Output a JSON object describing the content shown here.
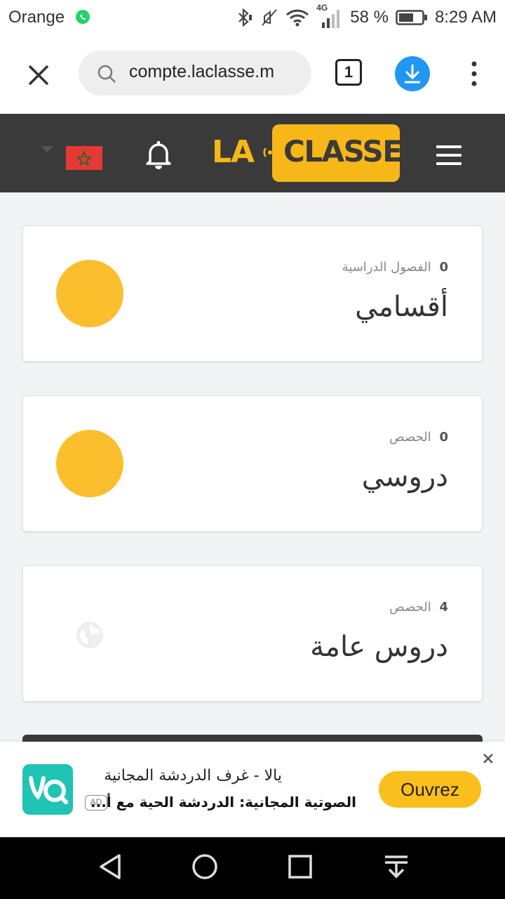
{
  "status_bar": {
    "carrier": "Orange",
    "network": "4G",
    "battery": "58 %",
    "time": "8:29 AM",
    "icons": [
      "whatsapp-icon",
      "bluetooth-icon",
      "mute-icon",
      "wifi-icon",
      "signal-icon",
      "battery-icon"
    ]
  },
  "browser": {
    "url": "compte.laclasse.m",
    "tab_count": "1",
    "icons": [
      "close-icon",
      "search-icon",
      "download-icon",
      "more-icon"
    ]
  },
  "site_header": {
    "logo_left": "LA",
    "logo_right": "CLASSE",
    "brand_color": "#f7b718",
    "header_bg": "#3a3a3a",
    "icons": [
      "flag-icon",
      "bell-icon",
      "hamburger-icon"
    ]
  },
  "cards": [
    {
      "count": "0",
      "subtitle": "الفصول الدراسية",
      "title": "أقسامي",
      "icon": "yellow-dot"
    },
    {
      "count": "0",
      "subtitle": "الحصص",
      "title": "دروسي",
      "icon": "yellow-dot"
    },
    {
      "count": "4",
      "subtitle": "الحصص",
      "title": "دروس عامة",
      "icon": "globe-icon"
    }
  ],
  "ad": {
    "headline": "يالا - غرف الدردشة المجانية",
    "subline": "الصوتية المجانية: الدردشة الحية مع أ...",
    "badge": "AD",
    "cta": "Ouvrez",
    "cta_color": "#fbbf1d",
    "icon_color": "#1fc4b4"
  },
  "nav_bar": {
    "icons": [
      "back-icon",
      "home-icon",
      "recents-icon",
      "notifications-pull-icon"
    ]
  }
}
